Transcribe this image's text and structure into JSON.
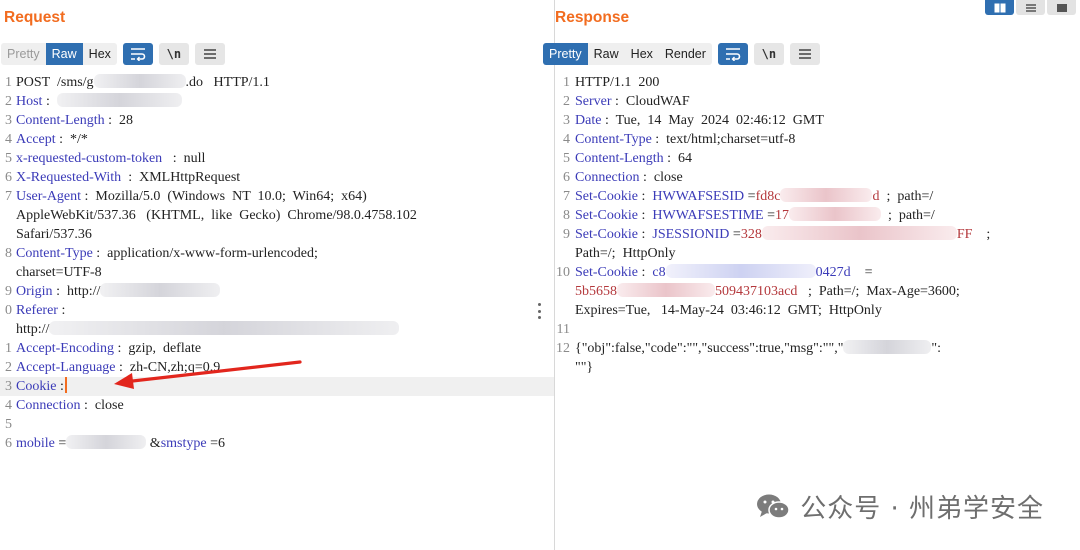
{
  "request": {
    "title": "Request",
    "tabs": [
      "Pretty",
      "Raw",
      "Hex"
    ],
    "active_tab": "Raw",
    "newline_label": "\\n",
    "lines": [
      {
        "n": "1",
        "parts": [
          [
            "v",
            "POST  /sms/g"
          ],
          [
            "blur",
            ""
          ],
          [
            "v",
            ".do   HTTP/1.1"
          ]
        ]
      },
      {
        "n": "2",
        "parts": [
          [
            "k",
            "Host"
          ],
          [
            "v",
            " :  "
          ],
          [
            "blur",
            ""
          ]
        ]
      },
      {
        "n": "3",
        "parts": [
          [
            "k",
            "Content-Length"
          ],
          [
            "v",
            " :  28"
          ]
        ]
      },
      {
        "n": "4",
        "parts": [
          [
            "k",
            "Accept"
          ],
          [
            "v",
            " :  */*"
          ]
        ]
      },
      {
        "n": "5",
        "parts": [
          [
            "k",
            "x-requested-custom-token"
          ],
          [
            "v",
            "   :  null"
          ]
        ]
      },
      {
        "n": "6",
        "parts": [
          [
            "k",
            "X-Requested-With"
          ],
          [
            "v",
            "  :  XMLHttpRequest"
          ]
        ]
      },
      {
        "n": "7",
        "parts": [
          [
            "k",
            "User-Agent"
          ],
          [
            "v",
            " :  Mozilla/5.0  (Windows  NT  10.0;  Win64;  x64)"
          ]
        ]
      },
      {
        "n": "",
        "parts": [
          [
            "v",
            "AppleWebKit/537.36   (KHTML,  like  Gecko)  Chrome/98.0.4758.102"
          ]
        ]
      },
      {
        "n": "",
        "parts": [
          [
            "v",
            "Safari/537.36"
          ]
        ]
      },
      {
        "n": "8",
        "parts": [
          [
            "k",
            "Content-Type"
          ],
          [
            "v",
            " :  application/x-www-form-urlencoded;"
          ]
        ]
      },
      {
        "n": "",
        "parts": [
          [
            "v",
            "charset=UTF-8"
          ]
        ]
      },
      {
        "n": "9",
        "parts": [
          [
            "k",
            "Origin"
          ],
          [
            "v",
            " :  http://"
          ],
          [
            "blur",
            ""
          ]
        ]
      },
      {
        "n": "0",
        "parts": [
          [
            "k",
            "Referer"
          ],
          [
            "v",
            " :"
          ]
        ]
      },
      {
        "n": "",
        "parts": [
          [
            "v",
            "http://"
          ],
          [
            "blur",
            ""
          ]
        ]
      },
      {
        "n": "1",
        "parts": [
          [
            "k",
            "Accept-Encoding"
          ],
          [
            "v",
            " :  gzip,  deflate"
          ]
        ]
      },
      {
        "n": "2",
        "parts": [
          [
            "k",
            "Accept-Language"
          ],
          [
            "v",
            " :  zh-CN,zh;q=0.9"
          ]
        ]
      },
      {
        "n": "3",
        "parts": [
          [
            "k",
            "Cookie"
          ],
          [
            "v",
            " :"
          ],
          [
            "caret",
            ""
          ]
        ],
        "highlight": true
      },
      {
        "n": "4",
        "parts": [
          [
            "k",
            "Connection"
          ],
          [
            "v",
            " :  close"
          ]
        ]
      },
      {
        "n": "5",
        "parts": []
      },
      {
        "n": "6",
        "parts": [
          [
            "k",
            "mobile"
          ],
          [
            "v",
            " ="
          ],
          [
            "blur",
            ""
          ],
          [
            "v",
            " &"
          ],
          [
            "k",
            "smstype"
          ],
          [
            "v",
            " =6"
          ]
        ]
      }
    ]
  },
  "response": {
    "title": "Response",
    "tabs": [
      "Pretty",
      "Raw",
      "Hex",
      "Render"
    ],
    "active_tab": "Pretty",
    "newline_label": "\\n",
    "lines": [
      {
        "n": "1",
        "parts": [
          [
            "v",
            "HTTP/1.1  200"
          ]
        ]
      },
      {
        "n": "2",
        "parts": [
          [
            "k",
            "Server"
          ],
          [
            "v",
            " :  CloudWAF"
          ]
        ]
      },
      {
        "n": "3",
        "parts": [
          [
            "k",
            "Date"
          ],
          [
            "v",
            " :  Tue,  14  May  2024  02:46:12  GMT"
          ]
        ]
      },
      {
        "n": "4",
        "parts": [
          [
            "k",
            "Content-Type"
          ],
          [
            "v",
            " :  text/html;charset=utf-8"
          ]
        ]
      },
      {
        "n": "5",
        "parts": [
          [
            "k",
            "Content-Length"
          ],
          [
            "v",
            " :  64"
          ]
        ]
      },
      {
        "n": "6",
        "parts": [
          [
            "k",
            "Connection"
          ],
          [
            "v",
            " :  close"
          ]
        ]
      },
      {
        "n": "7",
        "parts": [
          [
            "k",
            "Set-Cookie"
          ],
          [
            "v",
            " :  "
          ],
          [
            "blue",
            "HWWAFSESID"
          ],
          [
            "v",
            " ="
          ],
          [
            "s",
            "fd8c"
          ],
          [
            "blurp",
            ""
          ],
          [
            "s",
            "d"
          ],
          [
            "v",
            "  ;  path=/"
          ]
        ]
      },
      {
        "n": "8",
        "parts": [
          [
            "k",
            "Set-Cookie"
          ],
          [
            "v",
            " :  "
          ],
          [
            "blue",
            "HWWAFSESTIME"
          ],
          [
            "v",
            " ="
          ],
          [
            "s",
            "17"
          ],
          [
            "blurp",
            ""
          ],
          [
            "v",
            "  ;  path=/"
          ]
        ]
      },
      {
        "n": "9",
        "parts": [
          [
            "k",
            "Set-Cookie"
          ],
          [
            "v",
            " :  "
          ],
          [
            "blue",
            "JSESSIONID"
          ],
          [
            "v",
            " ="
          ],
          [
            "s",
            "328"
          ],
          [
            "blurp",
            ""
          ],
          [
            "s",
            "FF"
          ],
          [
            "v",
            "    ;"
          ]
        ]
      },
      {
        "n": "",
        "parts": [
          [
            "v",
            "Path=/;  HttpOnly"
          ]
        ]
      },
      {
        "n": "10",
        "parts": [
          [
            "k",
            "Set-Cookie"
          ],
          [
            "v",
            " :  "
          ],
          [
            "blue",
            "c8"
          ],
          [
            "blurl",
            ""
          ],
          [
            "blue",
            "0427d"
          ],
          [
            "v",
            "    ="
          ]
        ]
      },
      {
        "n": "",
        "parts": [
          [
            "s",
            "5b5658"
          ],
          [
            "blurp",
            ""
          ],
          [
            "s",
            "509437103acd"
          ],
          [
            "v",
            "   ;  Path=/;  Max-Age=3600;"
          ]
        ]
      },
      {
        "n": "",
        "parts": [
          [
            "v",
            "Expires=Tue,   14-May-24  03:46:12  GMT;  HttpOnly"
          ]
        ]
      },
      {
        "n": "11",
        "parts": []
      },
      {
        "n": "12",
        "parts": [
          [
            "v",
            "{\"obj\":false,\"code\":\"\",\"success\":true,\"msg\":\"\",\""
          ],
          [
            "blur",
            ""
          ],
          [
            "v",
            "\":"
          ]
        ]
      },
      {
        "n": "",
        "parts": [
          [
            "v",
            "\"\"}"
          ]
        ]
      }
    ]
  },
  "watermark": "公众号 · 州弟学安全"
}
